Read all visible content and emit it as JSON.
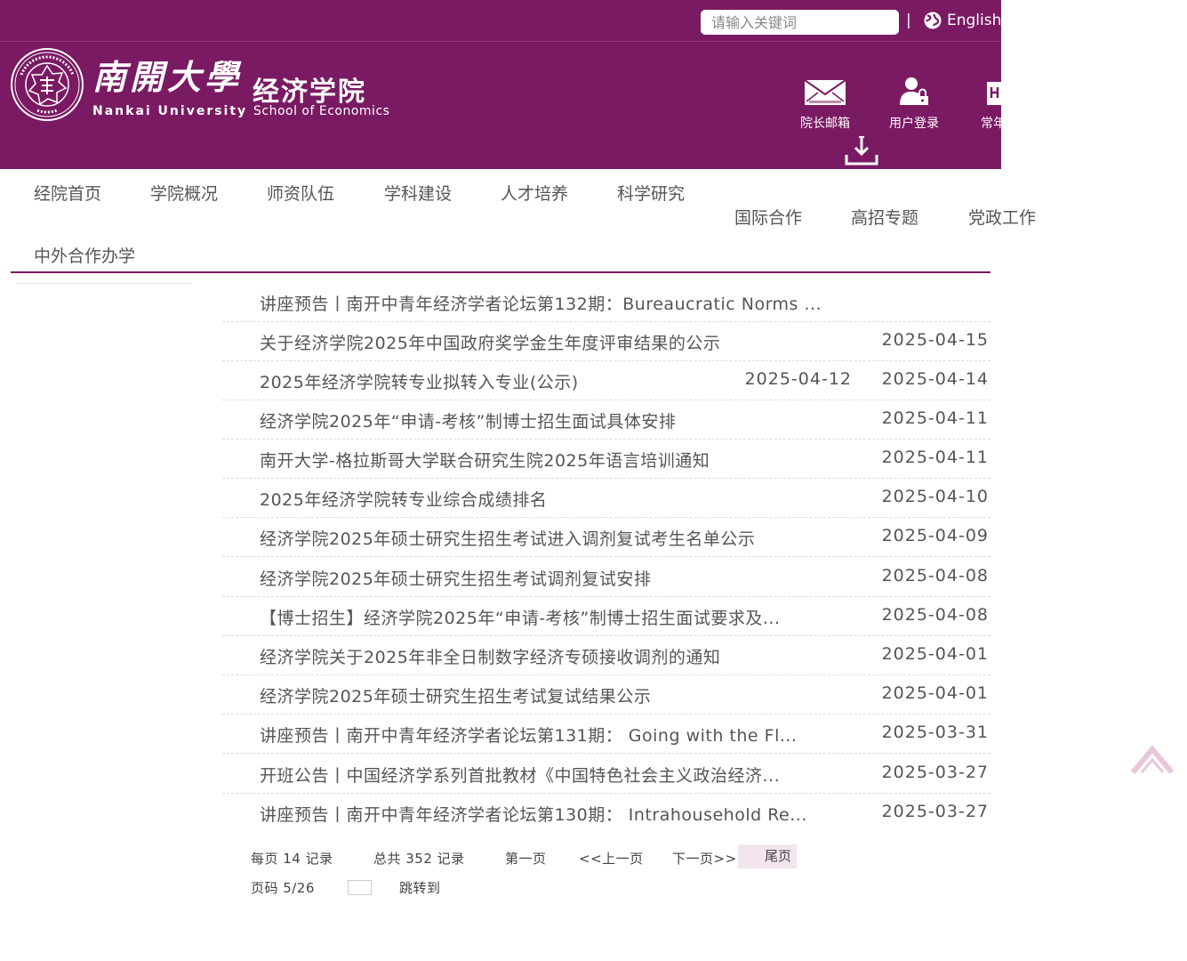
{
  "header": {
    "search_placeholder": "请输入关键词",
    "separator": "|",
    "lang_label": "English",
    "cn_name": "南開大學",
    "cn_school": "经济学院",
    "en_name": "Nankai University",
    "en_school": "School of Economics",
    "quick_links": [
      {
        "label": "院长邮箱",
        "icon": "mail-icon"
      },
      {
        "label": "用户登录",
        "icon": "user-lock-icon"
      },
      {
        "label": "常年",
        "icon": "building-icon"
      }
    ]
  },
  "nav": {
    "items": [
      "经院首页",
      "学院概况",
      "师资队伍",
      "学科建设",
      "人才培养",
      "科学研究",
      "国际合作",
      "高招专题",
      "党政工作",
      "中外合作办学"
    ]
  },
  "news": [
    {
      "title": "讲座预告丨南开中青年经济学者论坛第132期：Bureaucratic Norms ...",
      "date": ""
    },
    {
      "title": "关于经济学院2025年中国政府奖学金生年度评审结果的公示",
      "date": "2025-04-15"
    },
    {
      "title": "2025年经济学院转专业拟转入专业(公示)",
      "date2": "2025-04-12",
      "date": "2025-04-14"
    },
    {
      "title": "经济学院2025年“申请-考核”制博士招生面试具体安排",
      "date": "2025-04-11"
    },
    {
      "title": "南开大学-格拉斯哥大学联合研究生院2025年语言培训通知",
      "date": "2025-04-11"
    },
    {
      "title": "2025年经济学院转专业综合成绩排名",
      "date": "2025-04-10"
    },
    {
      "title": "经济学院2025年硕士研究生招生考试进入调剂复试考生名单公示",
      "date": "2025-04-09"
    },
    {
      "title": "经济学院2025年硕士研究生招生考试调剂复试安排",
      "date": "2025-04-08"
    },
    {
      "title": "【博士招生】经济学院2025年“申请-考核”制博士招生面试要求及...",
      "date": "2025-04-08"
    },
    {
      "title": "经济学院关于2025年非全日制数字经济专硕接收调剂的通知",
      "date": "2025-04-01"
    },
    {
      "title": "经济学院2025年硕士研究生招生考试复试结果公示",
      "date": "2025-04-01"
    },
    {
      "title": "讲座预告丨南开中青年经济学者论坛第131期： Going with the Fl...",
      "date": "2025-03-31"
    },
    {
      "title": "开班公告丨中国经济学系列首批教材《中国特色社会主义政治经济...",
      "date": "2025-03-27"
    },
    {
      "title": "讲座预告丨南开中青年经济学者论坛第130期： Intrahousehold Re...",
      "date": "2025-03-27"
    }
  ],
  "pager": {
    "per_page": "每页 14 记录",
    "total": "总共 352 记录",
    "first": "第一页",
    "prev": "<<上一页",
    "next": "下一页>>",
    "last": "尾页",
    "page_code": "页码 5/26",
    "jump": "跳转到"
  },
  "colors": {
    "brand": "#7a1a63",
    "back_top": "#e8c7dd"
  }
}
